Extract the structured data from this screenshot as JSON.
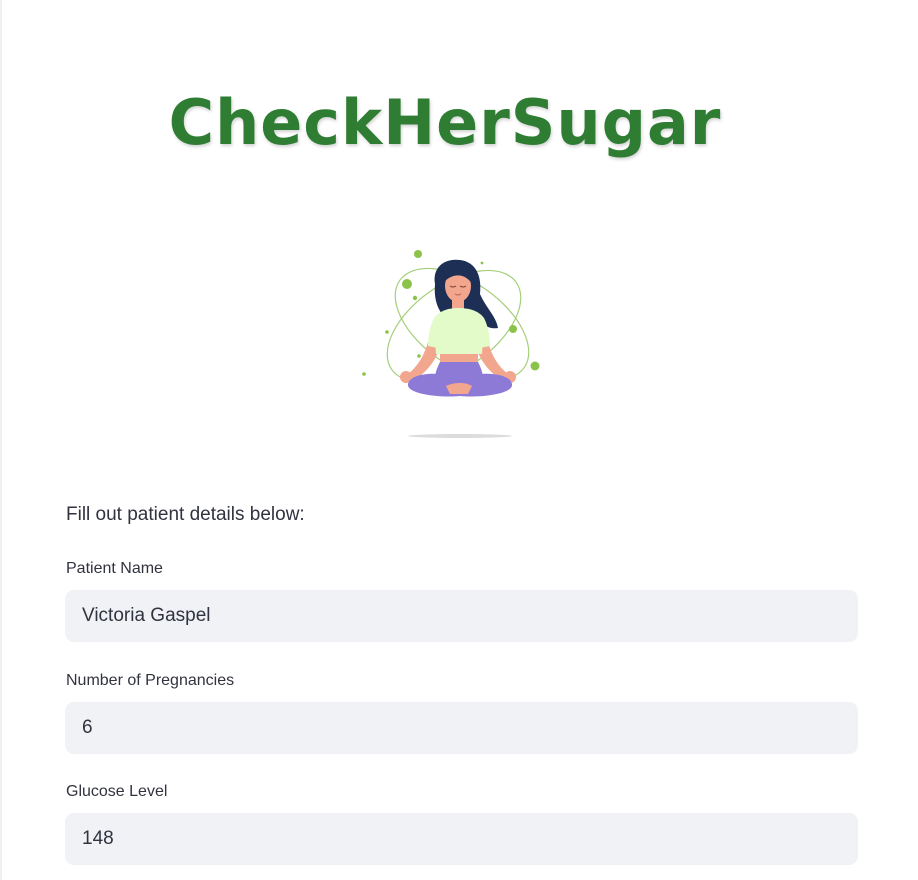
{
  "app": {
    "title": "CheckHerSugar"
  },
  "form": {
    "instructions": "Fill out patient details below:",
    "fields": [
      {
        "label": "Patient Name",
        "value": "Victoria Gaspel"
      },
      {
        "label": "Number of Pregnancies",
        "value": "6"
      },
      {
        "label": "Glucose Level",
        "value": "148"
      }
    ]
  },
  "colors": {
    "title_green": "#2e7d32",
    "input_background": "#f0f2f6",
    "text": "#31333f",
    "accent_green": "#8bc34a",
    "pants_purple": "#8c7ad6",
    "shirt_mint": "#e3fbc8",
    "hair_navy": "#1d2f55"
  },
  "illustration": {
    "icon": "meditating-woman-illustration"
  }
}
